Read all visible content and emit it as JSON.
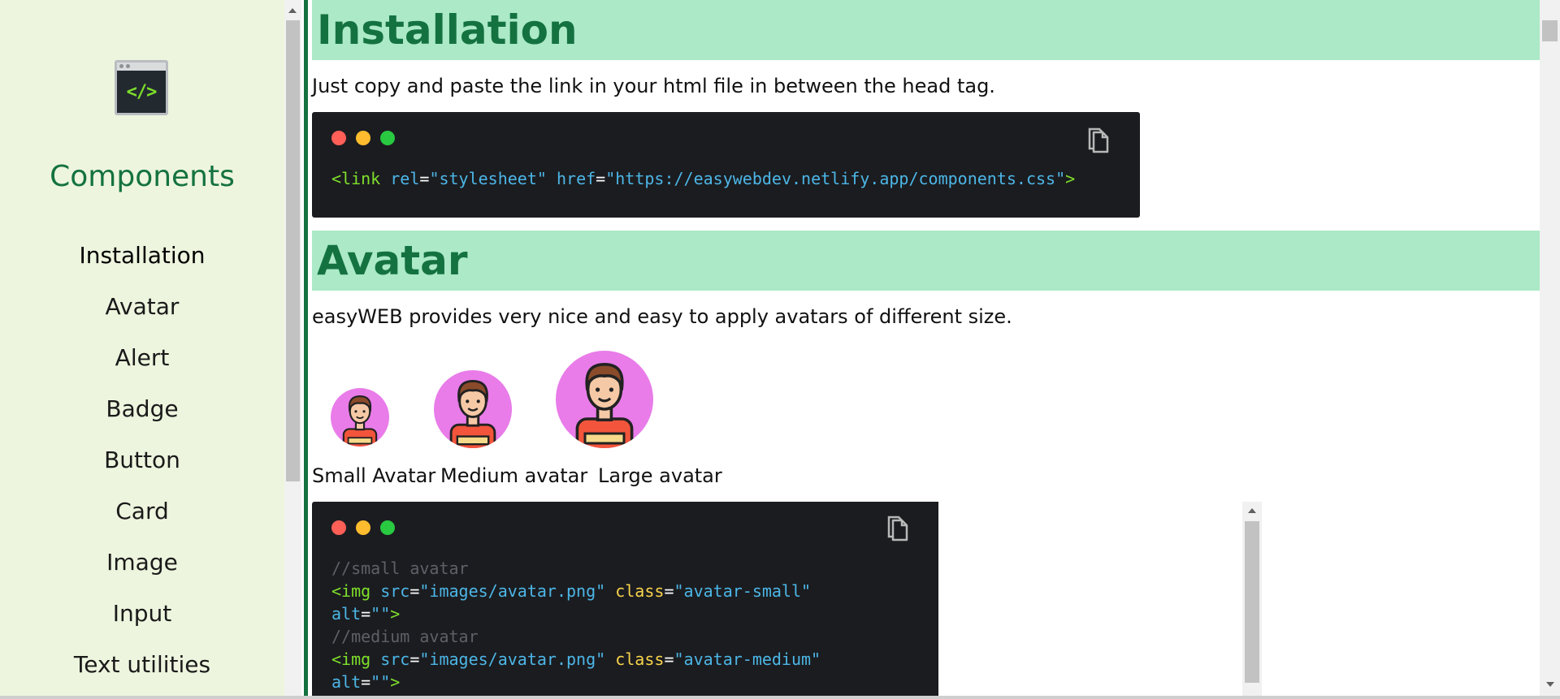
{
  "sidebar": {
    "logo_text": "</>",
    "brand": "Components",
    "items": [
      {
        "label": "Installation",
        "active": true
      },
      {
        "label": "Avatar"
      },
      {
        "label": "Alert"
      },
      {
        "label": "Badge"
      },
      {
        "label": "Button"
      },
      {
        "label": "Card"
      },
      {
        "label": "Image"
      },
      {
        "label": "Input"
      },
      {
        "label": "Text utilities"
      }
    ]
  },
  "installation": {
    "title": "Installation",
    "description": "Just copy and paste the link in your html file in between the head tag.",
    "code": {
      "tag_open": "<link",
      "attr_rel": "rel",
      "val_rel": "\"stylesheet\"",
      "attr_href": "href",
      "val_href": "\"https://easywebdev.netlify.app/components.css\"",
      "tag_close": ">"
    }
  },
  "avatar": {
    "title": "Avatar",
    "description": "easyWEB provides very nice and easy to apply avatars of different size.",
    "labels": [
      "Small Avatar",
      "Medium avatar",
      "Large avatar"
    ],
    "code": {
      "comment_small": "//small avatar",
      "comment_medium": "//medium avatar",
      "tag_open": "<img",
      "attr_src": "src",
      "val_src": "\"images/avatar.png\"",
      "attr_class": "class",
      "val_class_small": "\"avatar-small\"",
      "val_class_medium": "\"avatar-medium\"",
      "attr_alt": "alt",
      "val_alt": "\"\"",
      "tag_close": ">"
    }
  },
  "colors": {
    "sidebar_bg": "#edf5de",
    "accent": "#147240",
    "section_header_bg": "#abe9c7",
    "code_bg": "#1b1c20",
    "avatar_bg": "#e97ce9"
  }
}
